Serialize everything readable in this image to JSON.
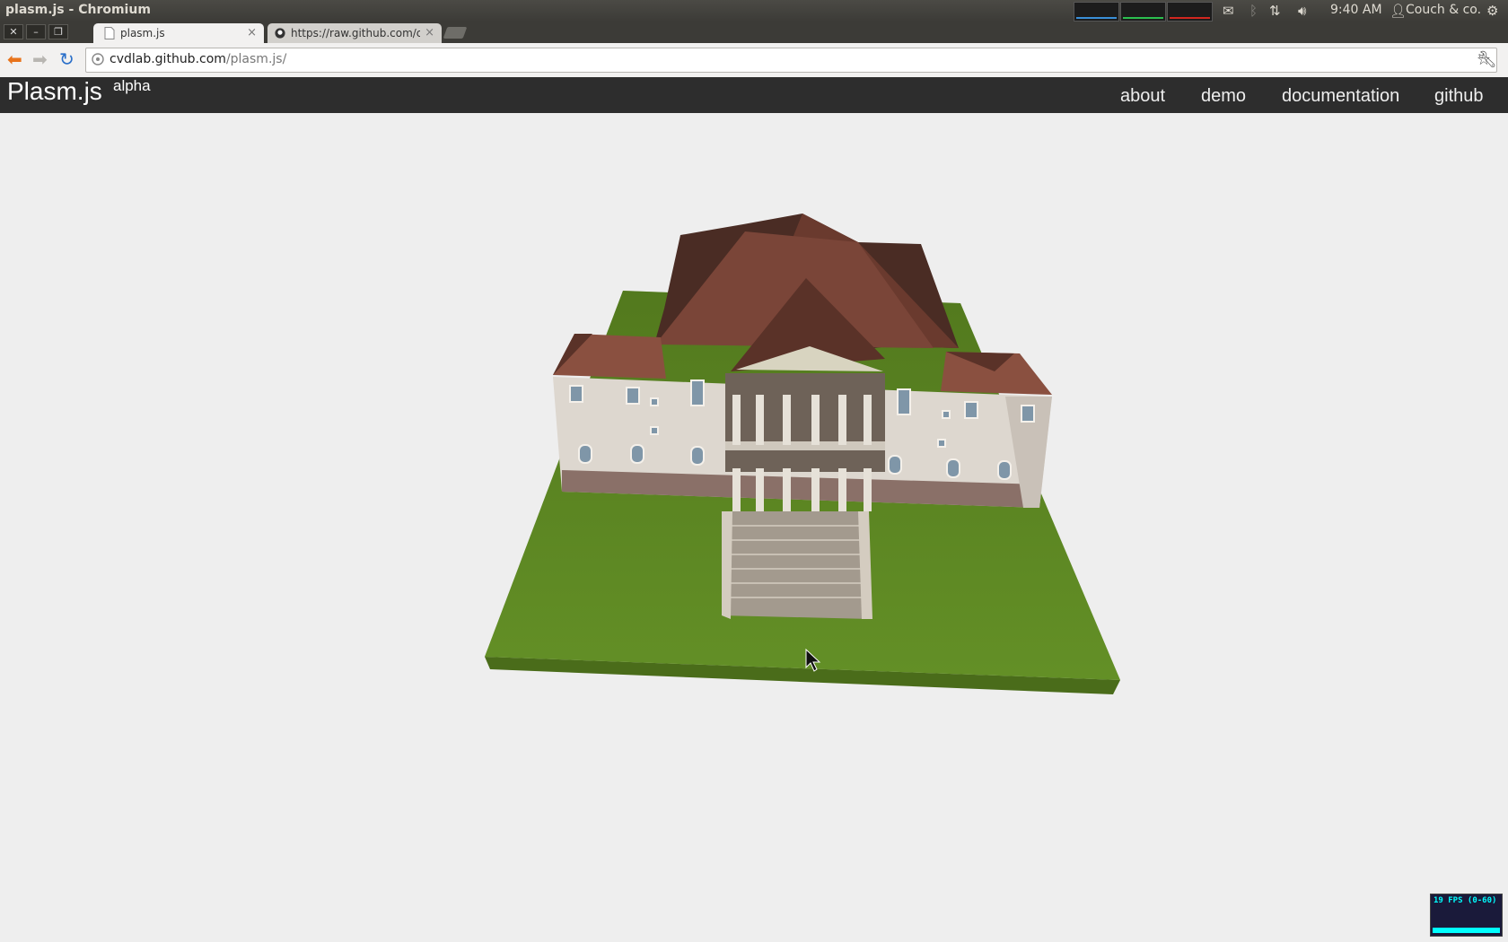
{
  "os": {
    "window_title": "plasm.js - Chromium",
    "clock": "9:40 AM",
    "user": "Couch & co."
  },
  "browser": {
    "tabs": [
      {
        "label": "plasm.js",
        "close": "×",
        "active": true
      },
      {
        "label": "https://raw.github.com/cv",
        "close": "×",
        "active": false
      }
    ],
    "url_host": "cvdlab.github.com",
    "url_path": "/plasm.js/"
  },
  "site": {
    "brand": "Plasm.js",
    "brand_badge": "alpha",
    "nav": [
      "about",
      "demo",
      "documentation",
      "github"
    ]
  },
  "fps": {
    "label": "19 FPS (0-60)",
    "value": 19,
    "range": [
      0,
      60
    ]
  },
  "colors": {
    "nav_bg": "#2d2d2d",
    "page_bg": "#eeeeee",
    "lawn": "#5f8a24",
    "roof": "#7a4538",
    "walls": "#ddd7cf"
  }
}
